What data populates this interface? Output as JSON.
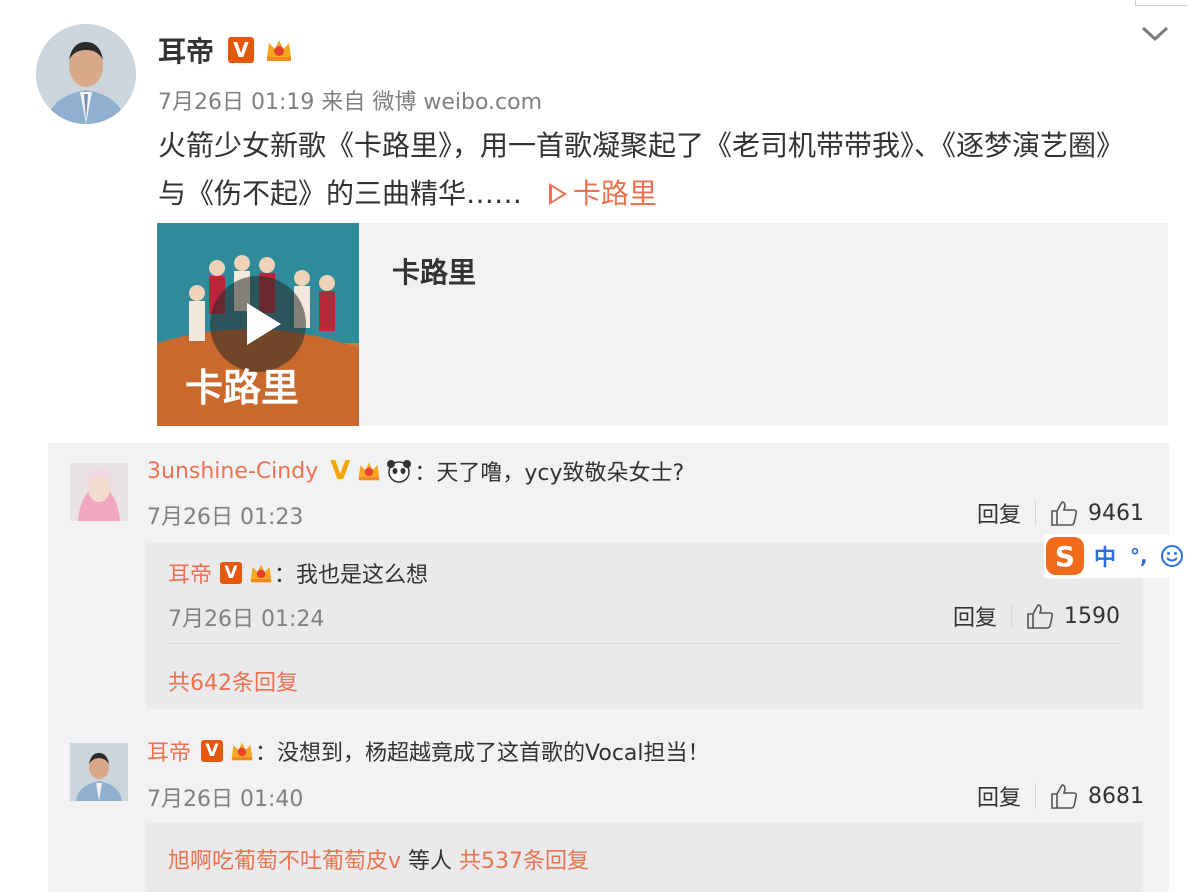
{
  "post": {
    "author": "耳帝",
    "v_badge": "V",
    "time": "7月26日 01:19 来自 微博 weibo.com",
    "text_main": "火箭少女新歌《卡路里》，用一首歌凝聚起了《老司机带带我》、《逐梦演艺圈》与《伤不起》的三曲精华……",
    "link_label": "卡路里",
    "card": {
      "title": "卡路里",
      "thumb_text": "卡路里"
    }
  },
  "comments": [
    {
      "user": "3unshine-Cindy",
      "badge": "V",
      "text": "：天了噜，ycy致敬朵女士?",
      "time": "7月26日 01:23",
      "reply_label": "回复",
      "likes": "9461",
      "reply": {
        "user": "耳帝",
        "badge": "V",
        "text": "：我也是这么想",
        "time": "7月26日 01:24",
        "reply_label": "回复",
        "likes": "1590"
      },
      "more": "共642条回复"
    },
    {
      "user": "耳帝",
      "badge": "V",
      "text": "：没想到，杨超越竟成了这首歌的Vocal担当！",
      "time": "7月26日 01:40",
      "reply_label": "回复",
      "likes": "8681",
      "more_user": "旭啊吃葡萄不吐葡萄皮v",
      "more_mid": " 等人 ",
      "more_count": "共537条回复"
    }
  ],
  "ime": {
    "zh": "中",
    "punc": "°,"
  },
  "colors": {
    "accent": "#eb7350",
    "v_badge": "#e4580b",
    "gold_v": "#f7a600",
    "panel": "#f2f2f5"
  }
}
